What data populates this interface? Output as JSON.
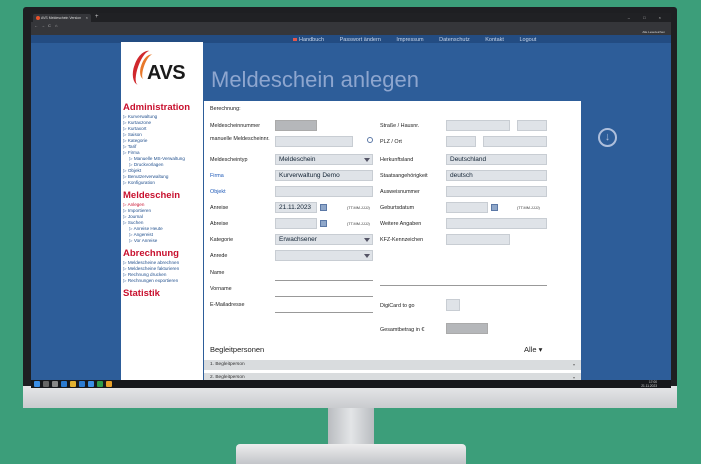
{
  "browser": {
    "tab_title": "AVS Meldeschein Version",
    "tab_close": "×",
    "new_tab": "+",
    "window_controls": "–  □  ×",
    "nav_back": "←",
    "nav_forward": "→",
    "nav_reload": "C",
    "nav_home": "⌂",
    "bookmarks_label": "Alle Lesezeichen"
  },
  "top_links": [
    "Handbuch",
    "Passwort ändern",
    "Impressum",
    "Datenschutz",
    "Kontakt",
    "Logout"
  ],
  "logo_text": "AVS",
  "page_title": "Meldeschein anlegen",
  "sidebar": {
    "administration": {
      "title": "Administration",
      "items": [
        "Kurverwaltung",
        "Kurtaxzone",
        "Kurtaxort",
        "Saison",
        "Kategorie",
        "Tarif",
        "Firma"
      ],
      "sub_items": [
        "Manuelle MS-Verwaltung",
        "Druckvorlagen"
      ],
      "items2": [
        "Objekt",
        "Benutzerverwaltung",
        "Konfiguration"
      ]
    },
    "meldeschein": {
      "title": "Meldeschein",
      "items": [
        "Anlegen",
        "Importieren",
        "Journal",
        "Suchen"
      ],
      "sub_items": [
        "Anreise Heute",
        "Angereist",
        "Vor Anreise"
      ]
    },
    "abrechnung": {
      "title": "Abrechnung",
      "items": [
        "Meldescheine abrechnen",
        "Meldescheine fakturieren",
        "Rechnung drucken",
        "Rechnungen exportieren"
      ]
    },
    "statistik": {
      "title": "Statistik"
    }
  },
  "form": {
    "berechnung": "Berechnung:",
    "meldescheinnummer": "Meldescheinnummer",
    "manuelle_nr": "manuelle Meldescheinnr.",
    "meldescheintyp": "Meldescheintyp",
    "meldescheintyp_value": "Meldeschein",
    "firma": "Firma",
    "firma_value": "Kurverwaltung Demo",
    "objekt": "Objekt",
    "anreise": "Anreise",
    "anreise_value": "21.11.2023",
    "abreise": "Abreise",
    "date_format": "(TT.MM.JJJJ)",
    "kategorie": "Kategorie",
    "kategorie_value": "Erwachsener",
    "anrede": "Anrede",
    "name": "Name",
    "vorname": "Vorname",
    "email": "E-Mailadresse",
    "strasse": "Straße / Hausnr.",
    "plz_ort": "PLZ / Ort",
    "herkunftsland": "Herkunftsland",
    "herkunftsland_value": "Deutschland",
    "staatsangehoerigkeit": "Staatsangehörigkeit",
    "staatsangehoerigkeit_value": "deutsch",
    "ausweisnummer": "Ausweisnummer",
    "geburtsdatum": "Geburtsdatum",
    "weitere_angaben": "Weitere Angaben",
    "kfz": "KFZ-Kennzeichen",
    "digicard": "DigiCard to go",
    "gesamtbetrag": "Gesamtbetrag in €"
  },
  "begleitpersonen": {
    "title": "Begleitpersonen",
    "filter": "Alle",
    "rows": [
      "1. Begleitperson",
      "2. Begleitperson"
    ]
  },
  "taskbar": {
    "time": "17:00",
    "date": "21.11.2023"
  }
}
